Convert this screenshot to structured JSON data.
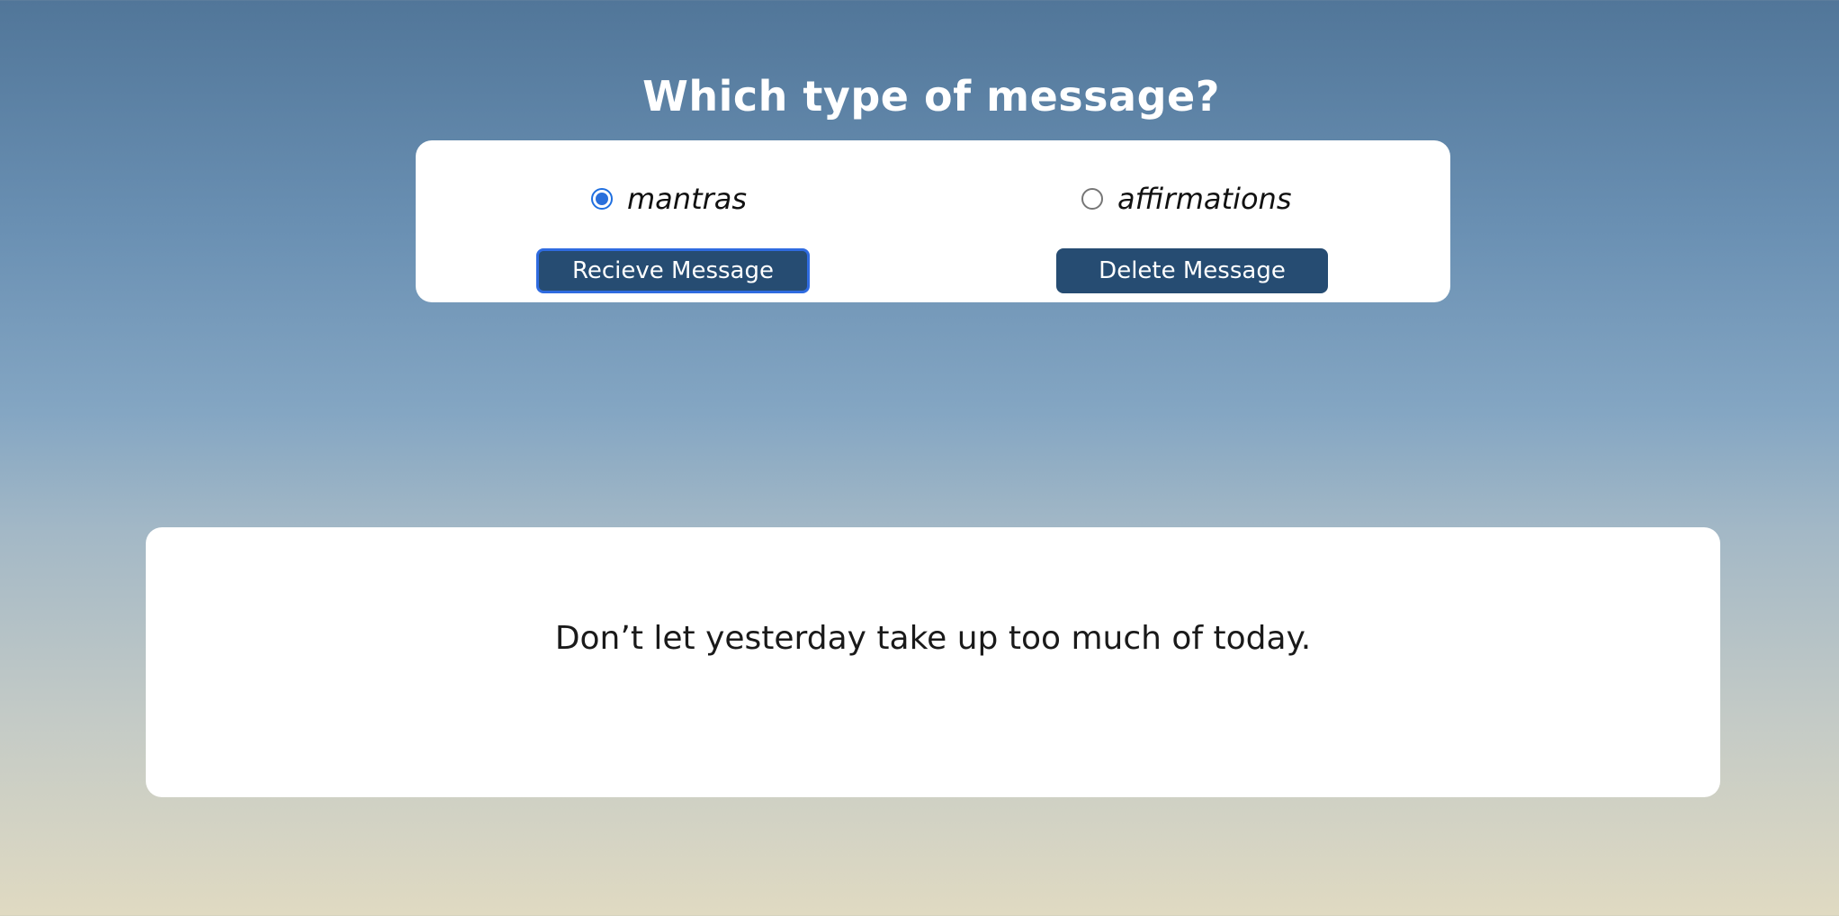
{
  "heading": "Which type of message?",
  "options": [
    {
      "label": "mantras",
      "checked": true
    },
    {
      "label": "affirmations",
      "checked": false
    }
  ],
  "buttons": {
    "receive": "Recieve Message",
    "delete": "Delete Message"
  },
  "message": "Don’t let yesterday take up too much of today.",
  "colors": {
    "button_bg": "#264c72",
    "focus_ring": "#2f6be0",
    "radio_checked": "#2a6fdb",
    "card_bg": "#ffffff",
    "gradient_top": "#517699",
    "gradient_bottom": "#e0dac2"
  }
}
